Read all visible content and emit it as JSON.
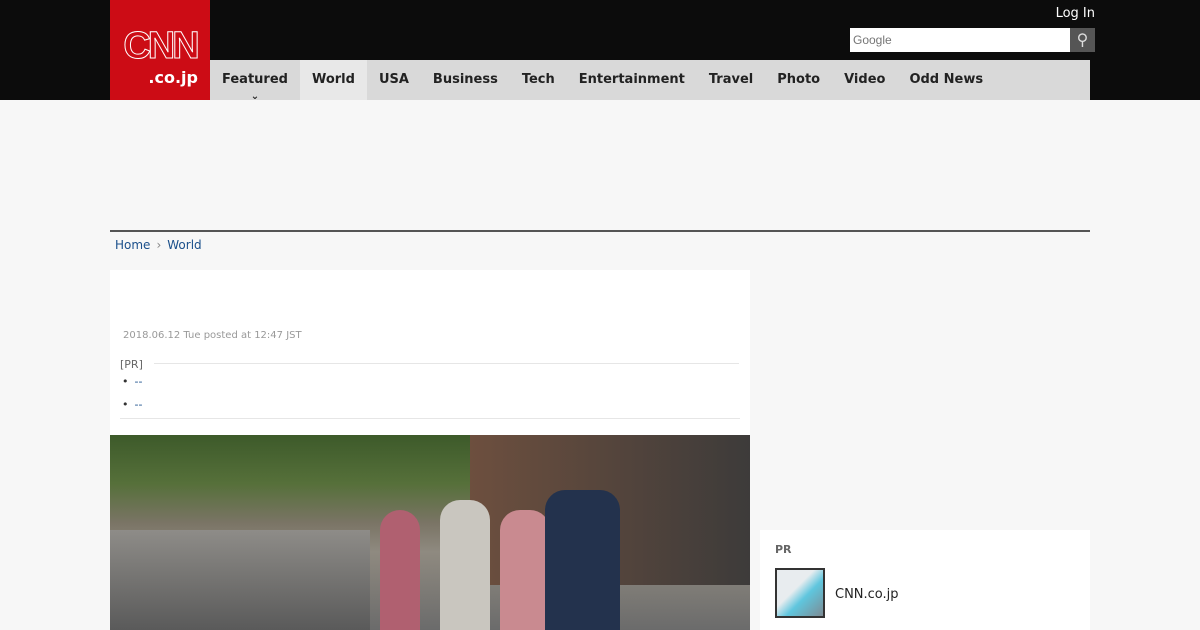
{
  "header": {
    "logo_main": "CNN",
    "logo_sub": ".co.jp",
    "login": "Log In",
    "search_placeholder": "Google",
    "search_icon": "magnifier-icon"
  },
  "nav": [
    {
      "label": "Featured"
    },
    {
      "label": "World"
    },
    {
      "label": "USA"
    },
    {
      "label": "Business"
    },
    {
      "label": "Tech"
    },
    {
      "label": "Entertainment"
    },
    {
      "label": "Travel"
    },
    {
      "label": "Photo"
    },
    {
      "label": "Video"
    },
    {
      "label": "Odd News"
    }
  ],
  "breadcrumb": {
    "home": "Home",
    "sep": "›",
    "current": "World"
  },
  "article": {
    "date": "2018.06.12 Tue posted at 12:47 JST",
    "pr_label": "[PR]",
    "pr_links": [
      "--",
      "--"
    ]
  },
  "sidebar": {
    "pr_heading": "PR",
    "pr_item": "CNN.co.jp"
  },
  "colors": {
    "brand": "#cc0c15",
    "link": "#1a4f8b"
  }
}
